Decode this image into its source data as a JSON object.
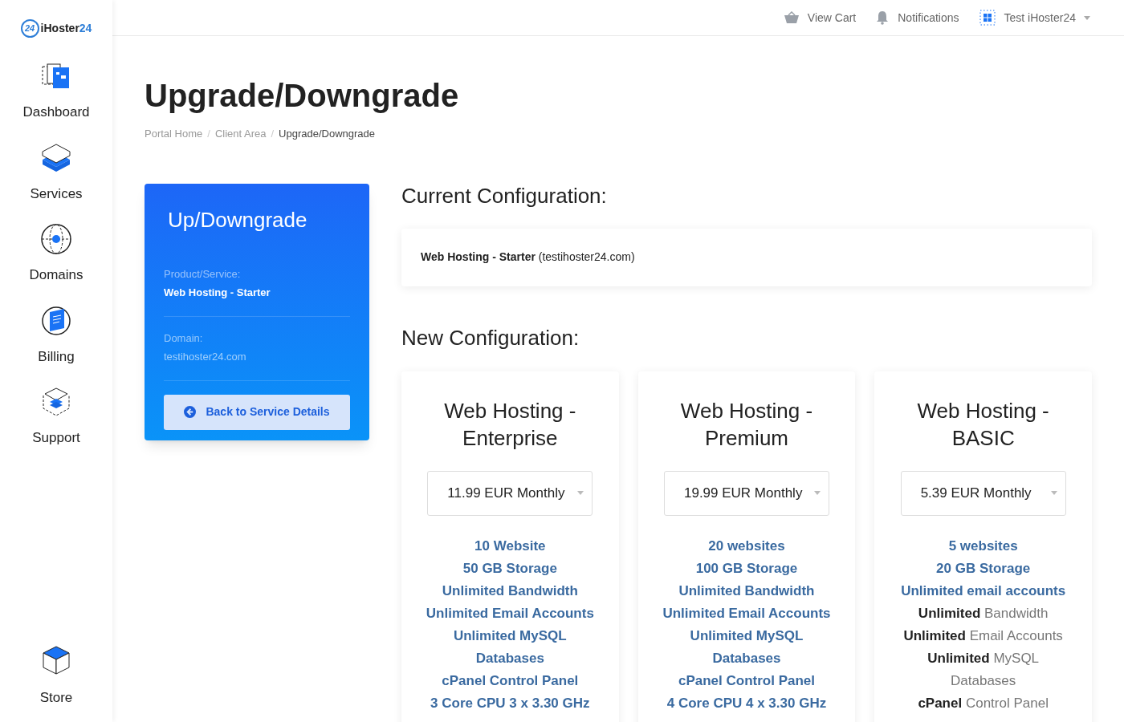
{
  "brand": {
    "name": "iHoster",
    "suffix": "24",
    "badge": "24"
  },
  "sidebar": {
    "items": [
      {
        "label": "Dashboard",
        "kind": "dashboard"
      },
      {
        "label": "Services",
        "kind": "services"
      },
      {
        "label": "Domains",
        "kind": "domains"
      },
      {
        "label": "Billing",
        "kind": "billing"
      },
      {
        "label": "Support",
        "kind": "support"
      }
    ],
    "bottom_item": {
      "label": "Store",
      "kind": "store"
    }
  },
  "topbar": {
    "links": [
      {
        "label": "View Cart",
        "kind": "cart"
      },
      {
        "label": "Notifications",
        "kind": "bell"
      },
      {
        "label": "Test iHoster24",
        "kind": "account"
      }
    ]
  },
  "page_title": "Upgrade/Downgrade",
  "breadcrumb_separator": "/",
  "breadcrumb": [
    {
      "label": "Portal Home",
      "selected": false
    },
    {
      "label": "Client Area",
      "selected": false
    },
    {
      "label": "Upgrade/Downgrade",
      "selected": true
    }
  ],
  "info_card": {
    "title": "Up/Downgrade",
    "fields": [
      {
        "label": "Product/Service:",
        "value": "Web Hosting - Starter",
        "kind": "bold"
      },
      {
        "label": "Domain:",
        "value": "testihoster24.com",
        "kind": "muted"
      }
    ],
    "button": "Back to Service Details"
  },
  "current": {
    "heading": "Current Configuration:",
    "text": "**Web Hosting - Starter** (testihoster24.com)"
  },
  "new": {
    "heading": "New Configuration:",
    "plans": [
      {
        "title": "Web Hosting - Enterprise",
        "price": "11.99 EUR Monthly",
        "features": [
          {
            "text": "10 Website",
            "kind": "highlight"
          },
          {
            "text": "50 GB Storage",
            "kind": "highlight"
          },
          {
            "text": "Unlimited Bandwidth",
            "kind": "highlight"
          },
          {
            "text": "Unlimited Email Accounts",
            "kind": "highlight"
          },
          {
            "text": "Unlimited MySQL Databases",
            "kind": "highlight"
          },
          {
            "text": "cPanel Control Panel",
            "kind": "highlight"
          },
          {
            "text": "3 Core CPU 3 x 3.30 GHz",
            "kind": "highlight"
          }
        ]
      },
      {
        "title": "Web Hosting - Premium",
        "price": "19.99 EUR Monthly",
        "features": [
          {
            "text": "20 websites",
            "kind": "highlight"
          },
          {
            "text": "100 GB Storage",
            "kind": "highlight"
          },
          {
            "text": "Unlimited Bandwidth",
            "kind": "highlight"
          },
          {
            "text": "Unlimited Email Accounts",
            "kind": "highlight"
          },
          {
            "text": "Unlimited MySQL Databases",
            "kind": "highlight"
          },
          {
            "text": "cPanel Control Panel",
            "kind": "highlight"
          },
          {
            "text": "4 Core CPU 4 x 3.30 GHz",
            "kind": "highlight"
          }
        ]
      },
      {
        "title": "Web Hosting - BASIC",
        "price": "5.39 EUR Monthly",
        "features": [
          {
            "text": "5 websites",
            "kind": "highlight"
          },
          {
            "text": "20 GB Storage",
            "kind": "highlight"
          },
          {
            "text": "Unlimited email accounts",
            "kind": "highlight"
          },
          {
            "text": "**Unlimited** Bandwidth",
            "kind": "plain"
          },
          {
            "text": "**Unlimited** Email Accounts",
            "kind": "plain"
          },
          {
            "text": "**Unlimited** MySQL Databases",
            "kind": "plain"
          },
          {
            "text": "**cPanel** Control Panel",
            "kind": "plain"
          }
        ]
      }
    ]
  }
}
